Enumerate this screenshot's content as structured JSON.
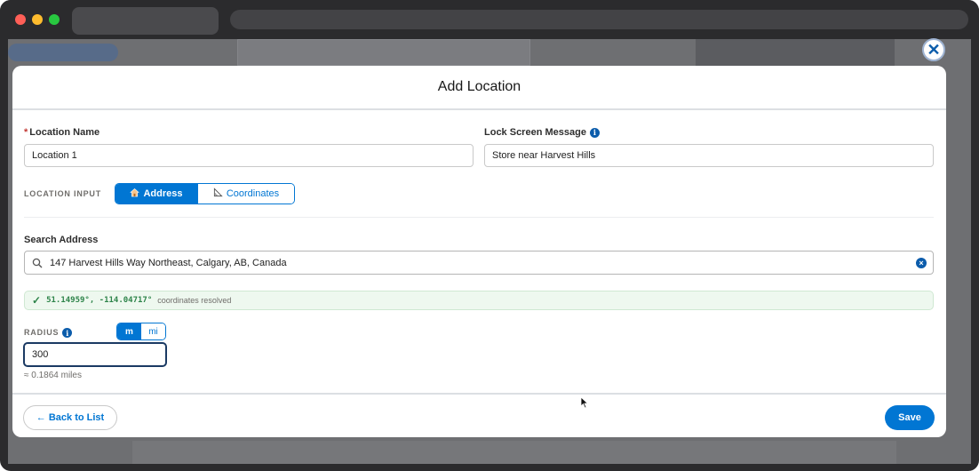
{
  "modal": {
    "title": "Add Location",
    "close_icon": "close-icon"
  },
  "form": {
    "location_name": {
      "required_marker": "*",
      "label": "Location Name",
      "value": "Location 1"
    },
    "lock_screen_message": {
      "label": "Lock Screen Message",
      "info_icon": "info-icon",
      "value": "Store near Harvest Hills"
    },
    "location_input": {
      "label": "LOCATION INPUT",
      "options": [
        {
          "label": "Address",
          "icon": "house-icon",
          "selected": true
        },
        {
          "label": "Coordinates",
          "icon": "ruler-icon",
          "selected": false
        }
      ]
    },
    "search_address": {
      "label": "Search Address",
      "value": "147 Harvest Hills Way Northeast, Calgary, AB, Canada",
      "search_icon": "search-icon",
      "clear_icon": "clear-icon"
    },
    "resolved": {
      "icon": "check-icon",
      "coordinates": "51.14959°, -114.04717°",
      "text": "coordinates resolved"
    },
    "radius": {
      "label": "RADIUS",
      "info_icon": "info-icon",
      "units": [
        {
          "label": "m",
          "selected": true
        },
        {
          "label": "mi",
          "selected": false
        }
      ],
      "value": "300",
      "conversion": "≈ 0.1864 miles"
    }
  },
  "footer": {
    "back_label": "← Back to List",
    "save_label": "Save"
  },
  "colors": {
    "brand": "#0176d3",
    "success": "#2e844a",
    "required": "#c23934"
  }
}
